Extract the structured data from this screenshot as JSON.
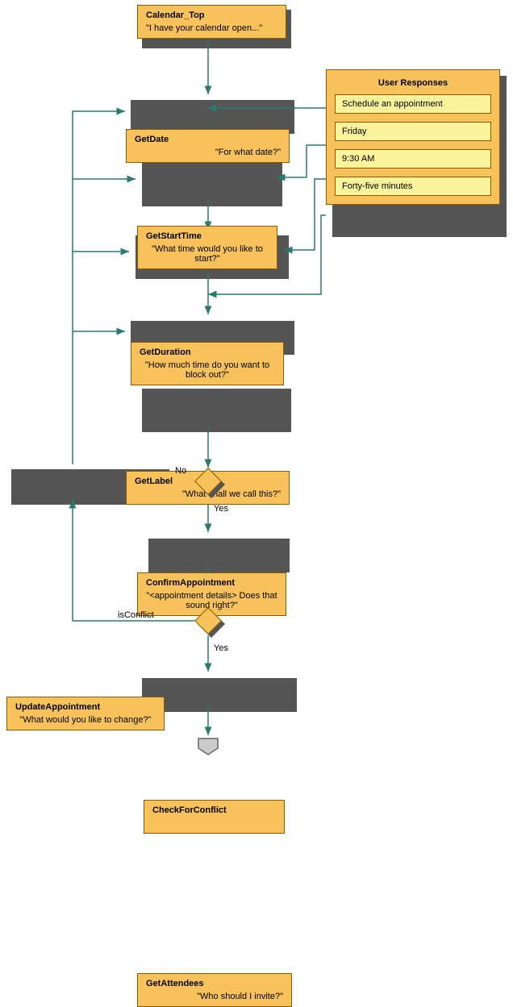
{
  "nodes": {
    "calendar_top": {
      "title": "Calendar_Top",
      "sub": "\"I have your calendar open...\""
    },
    "get_date": {
      "title": "GetDate",
      "sub": "\"For what date?\""
    },
    "get_start_time": {
      "title": "GetStartTime",
      "sub": "\"What time would you like to start?\""
    },
    "get_duration": {
      "title": "GetDuration",
      "sub": "\"How much time do you want to block out?\""
    },
    "get_label": {
      "title": "GetLabel",
      "sub": "\"What shall we call this?\""
    },
    "confirm": {
      "title": "ConfirmAppointment",
      "sub": "\"<appointment details> Does that sound right?\""
    },
    "update": {
      "title": "UpdateAppointment",
      "sub": "\"What would you like to change?\""
    },
    "conflict": {
      "title": "CheckForConflict",
      "sub": ""
    },
    "attendees": {
      "title": "GetAttendees",
      "sub": "\"Who should I invite?\""
    }
  },
  "user_panel": {
    "title": "User Responses",
    "items": [
      "Schedule an appointment",
      "Friday",
      "9:30 AM",
      "Forty-five minutes"
    ]
  },
  "decision_labels": {
    "no": "No",
    "yes1": "Yes",
    "is_conflict": "isConflict",
    "yes2": "Yes"
  }
}
